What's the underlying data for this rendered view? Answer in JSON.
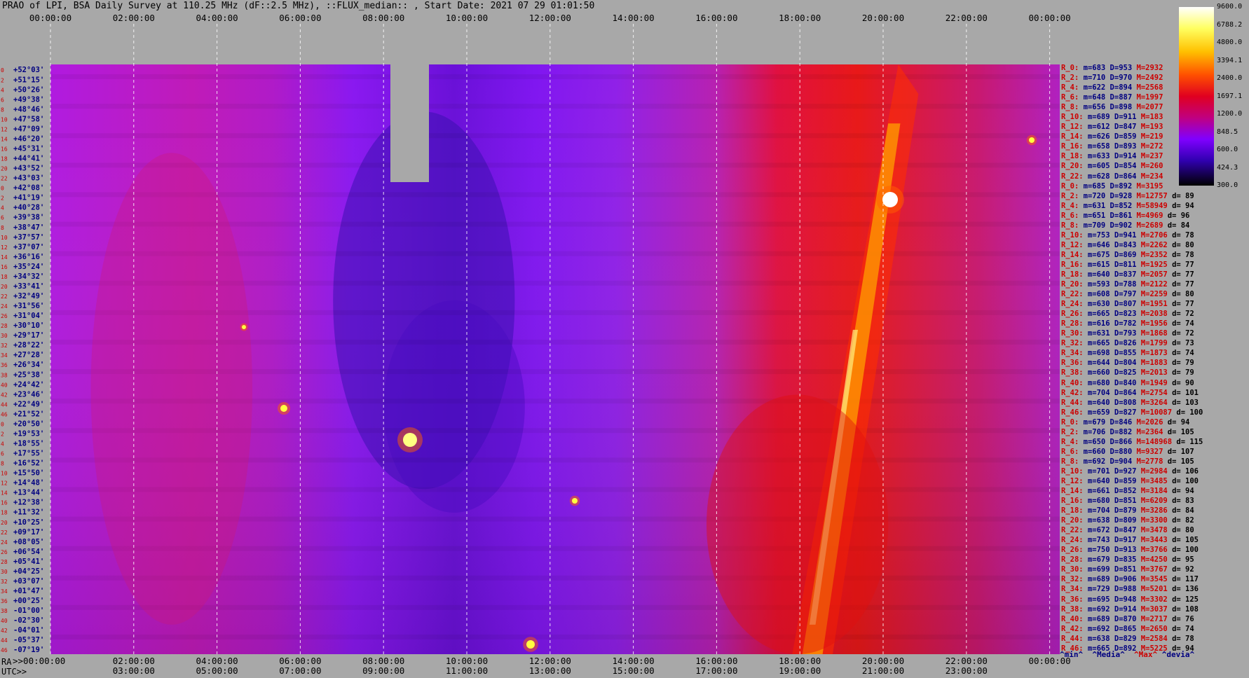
{
  "title": "PRAO of LPI, BSA Daily Survey at 110.25 MHz (dF::2.5 MHz), ::FLUX_median:: , Start Date: 2021 07 29 01:01:50",
  "chart_data": {
    "type": "heatmap",
    "top_axis_ticks": [
      "00:00:00",
      "02:00:00",
      "04:00:00",
      "06:00:00",
      "08:00:00",
      "10:00:00",
      "12:00:00",
      "14:00:00",
      "16:00:00",
      "18:00:00",
      "20:00:00",
      "22:00:00",
      "00:00:00"
    ],
    "bottom_ra_ticks": [
      ">>00:00:00",
      "02:00:00",
      "04:00:00",
      "06:00:00",
      "08:00:00",
      "10:00:00",
      "12:00:00",
      "14:00:00",
      "16:00:00",
      "18:00:00",
      "20:00:00",
      "22:00:00",
      "00:00:00"
    ],
    "bottom_utc_ticks": [
      "03:00:00",
      "05:00:00",
      "07:00:00",
      "09:00:00",
      "11:00:00",
      "13:00:00",
      "15:00:00",
      "17:00:00",
      "19:00:00",
      "21:00:00",
      "23:00:00"
    ],
    "ra_prefix": "RA",
    "utc_label": "UTC>>",
    "colorbar_ticks": [
      "9600.0",
      "6788.2",
      "4800.0",
      "3394.1",
      "2400.0",
      "1697.1",
      "1200.0",
      "848.5",
      "600.0",
      "424.3",
      "300.0"
    ],
    "declinations": [
      "+52°03'",
      "+51°15'",
      "+50°26'",
      "+49°38'",
      "+48°46'",
      "+47°58'",
      "+47°09'",
      "+46°20'",
      "+45°31'",
      "+44°41'",
      "+43°52'",
      "+43°03'",
      "+42°08'",
      "+41°19'",
      "+40°28'",
      "+39°38'",
      "+38°47'",
      "+37°57'",
      "+37°07'",
      "+36°16'",
      "+35°24'",
      "+34°32'",
      "+33°41'",
      "+32°49'",
      "+31°56'",
      "+31°04'",
      "+30°10'",
      "+29°17'",
      "+28°22'",
      "+27°28'",
      "+26°34'",
      "+25°38'",
      "+24°42'",
      "+23°46'",
      "+22°49'",
      "+21°52'",
      "+20°50'",
      "+19°53'",
      "+18°55'",
      "+17°55'",
      "+16°52'",
      "+15°50'",
      "+14°48'",
      "+13°44'",
      "+12°38'",
      "+11°32'",
      "+10°25'",
      "+09°17'",
      "+08°05'",
      "+06°54'",
      "+05°41'",
      "+04°25'",
      "+03°07'",
      "+01°47'",
      "+00°25'",
      "-01°00'",
      "-02°30'",
      "-04°01'",
      "-05°37'",
      "-07°19'"
    ],
    "beam_numbers": [
      "0",
      "2",
      "4",
      "6",
      "8",
      "10",
      "12",
      "14",
      "16",
      "18",
      "20",
      "22",
      "0",
      "2",
      "4",
      "6",
      "8",
      "10",
      "12",
      "14",
      "16",
      "18",
      "20",
      "22",
      "24",
      "26",
      "28",
      "30",
      "32",
      "34",
      "36",
      "38",
      "40",
      "42",
      "44",
      "46",
      "0",
      "2",
      "4",
      "6",
      "8",
      "10",
      "12",
      "14",
      "16",
      "18",
      "20",
      "22",
      "24",
      "26",
      "28",
      "30",
      "32",
      "34",
      "36",
      "38",
      "40",
      "42",
      "44",
      "46"
    ],
    "stats": [
      {
        "k": "R_0:",
        "m": "683",
        "D": "953",
        "M": "2932",
        "d": ""
      },
      {
        "k": "R_2:",
        "m": "710",
        "D": "970",
        "M": "2492",
        "d": ""
      },
      {
        "k": "R_4:",
        "m": "622",
        "D": "894",
        "M": "2568",
        "d": ""
      },
      {
        "k": "R_6:",
        "m": "648",
        "D": "887",
        "M": "1997",
        "d": ""
      },
      {
        "k": "R_8:",
        "m": "656",
        "D": "898",
        "M": "2077",
        "d": ""
      },
      {
        "k": "R_10:",
        "m": "689",
        "D": "911",
        "M": "183",
        "d": ""
      },
      {
        "k": "R_12:",
        "m": "612",
        "D": "847",
        "M": "193",
        "d": ""
      },
      {
        "k": "R_14:",
        "m": "626",
        "D": "859",
        "M": "219",
        "d": ""
      },
      {
        "k": "R_16:",
        "m": "658",
        "D": "893",
        "M": "272",
        "d": ""
      },
      {
        "k": "R_18:",
        "m": "633",
        "D": "914",
        "M": "237",
        "d": ""
      },
      {
        "k": "R_20:",
        "m": "605",
        "D": "854",
        "M": "260",
        "d": ""
      },
      {
        "k": "R_22:",
        "m": "628",
        "D": "864",
        "M": "234",
        "d": ""
      },
      {
        "k": "R_0:",
        "m": "685",
        "D": "892",
        "M": "3195",
        "d": ""
      },
      {
        "k": "R_2:",
        "m": "720",
        "D": "928",
        "M": "12757",
        "d": "89"
      },
      {
        "k": "R_4:",
        "m": "631",
        "D": "852",
        "M": "58949",
        "d": "94"
      },
      {
        "k": "R_6:",
        "m": "651",
        "D": "861",
        "M": "4969",
        "d": "96"
      },
      {
        "k": "R_8:",
        "m": "709",
        "D": "902",
        "M": "2689",
        "d": "84"
      },
      {
        "k": "R_10:",
        "m": "753",
        "D": "941",
        "M": "2706",
        "d": "78"
      },
      {
        "k": "R_12:",
        "m": "646",
        "D": "843",
        "M": "2262",
        "d": "80"
      },
      {
        "k": "R_14:",
        "m": "675",
        "D": "869",
        "M": "2352",
        "d": "78"
      },
      {
        "k": "R_16:",
        "m": "615",
        "D": "811",
        "M": "1925",
        "d": "77"
      },
      {
        "k": "R_18:",
        "m": "640",
        "D": "837",
        "M": "2057",
        "d": "77"
      },
      {
        "k": "R_20:",
        "m": "593",
        "D": "788",
        "M": "2122",
        "d": "77"
      },
      {
        "k": "R_22:",
        "m": "608",
        "D": "797",
        "M": "2259",
        "d": "80"
      },
      {
        "k": "R_24:",
        "m": "630",
        "D": "807",
        "M": "1951",
        "d": "77"
      },
      {
        "k": "R_26:",
        "m": "665",
        "D": "823",
        "M": "2038",
        "d": "72"
      },
      {
        "k": "R_28:",
        "m": "616",
        "D": "782",
        "M": "1956",
        "d": "74"
      },
      {
        "k": "R_30:",
        "m": "631",
        "D": "793",
        "M": "1868",
        "d": "72"
      },
      {
        "k": "R_32:",
        "m": "665",
        "D": "826",
        "M": "1799",
        "d": "73"
      },
      {
        "k": "R_34:",
        "m": "698",
        "D": "855",
        "M": "1873",
        "d": "74"
      },
      {
        "k": "R_36:",
        "m": "644",
        "D": "804",
        "M": "1883",
        "d": "79"
      },
      {
        "k": "R_38:",
        "m": "660",
        "D": "825",
        "M": "2013",
        "d": "79"
      },
      {
        "k": "R_40:",
        "m": "680",
        "D": "840",
        "M": "1949",
        "d": "90"
      },
      {
        "k": "R_42:",
        "m": "704",
        "D": "864",
        "M": "2754",
        "d": "101"
      },
      {
        "k": "R_44:",
        "m": "640",
        "D": "808",
        "M": "3264",
        "d": "103"
      },
      {
        "k": "R_46:",
        "m": "659",
        "D": "827",
        "M": "10087",
        "d": "100"
      },
      {
        "k": "R_0:",
        "m": "679",
        "D": "846",
        "M": "2026",
        "d": "94"
      },
      {
        "k": "R_2:",
        "m": "706",
        "D": "882",
        "M": "2364",
        "d": "105"
      },
      {
        "k": "R_4:",
        "m": "650",
        "D": "866",
        "M": "148968",
        "d": "115"
      },
      {
        "k": "R_6:",
        "m": "660",
        "D": "880",
        "M": "9327",
        "d": "107"
      },
      {
        "k": "R_8:",
        "m": "692",
        "D": "904",
        "M": "2778",
        "d": "105"
      },
      {
        "k": "R_10:",
        "m": "701",
        "D": "927",
        "M": "2984",
        "d": "106"
      },
      {
        "k": "R_12:",
        "m": "640",
        "D": "859",
        "M": "3485",
        "d": "100"
      },
      {
        "k": "R_14:",
        "m": "661",
        "D": "852",
        "M": "3184",
        "d": "94"
      },
      {
        "k": "R_16:",
        "m": "680",
        "D": "851",
        "M": "6209",
        "d": "83"
      },
      {
        "k": "R_18:",
        "m": "704",
        "D": "879",
        "M": "3286",
        "d": "84"
      },
      {
        "k": "R_20:",
        "m": "638",
        "D": "809",
        "M": "3300",
        "d": "82"
      },
      {
        "k": "R_22:",
        "m": "672",
        "D": "847",
        "M": "3478",
        "d": "80"
      },
      {
        "k": "R_24:",
        "m": "743",
        "D": "917",
        "M": "3443",
        "d": "105"
      },
      {
        "k": "R_26:",
        "m": "750",
        "D": "913",
        "M": "3766",
        "d": "100"
      },
      {
        "k": "R_28:",
        "m": "679",
        "D": "835",
        "M": "4250",
        "d": "95"
      },
      {
        "k": "R_30:",
        "m": "699",
        "D": "851",
        "M": "3767",
        "d": "92"
      },
      {
        "k": "R_32:",
        "m": "689",
        "D": "906",
        "M": "3545",
        "d": "117"
      },
      {
        "k": "R_34:",
        "m": "729",
        "D": "988",
        "M": "5201",
        "d": "136"
      },
      {
        "k": "R_36:",
        "m": "695",
        "D": "948",
        "M": "3302",
        "d": "125"
      },
      {
        "k": "R_38:",
        "m": "692",
        "D": "914",
        "M": "3037",
        "d": "108"
      },
      {
        "k": "R_40:",
        "m": "689",
        "D": "870",
        "M": "2717",
        "d": "76"
      },
      {
        "k": "R_42:",
        "m": "692",
        "D": "865",
        "M": "2650",
        "d": "74"
      },
      {
        "k": "R_44:",
        "m": "638",
        "D": "829",
        "M": "2584",
        "d": "78"
      },
      {
        "k": "R_46:",
        "m": "665",
        "D": "892",
        "M": "5225",
        "d": "94"
      }
    ],
    "legend_footer": {
      "min": "^min^",
      "median": "^Media^",
      "max": "^Max^",
      "devia": "^devia^"
    }
  }
}
